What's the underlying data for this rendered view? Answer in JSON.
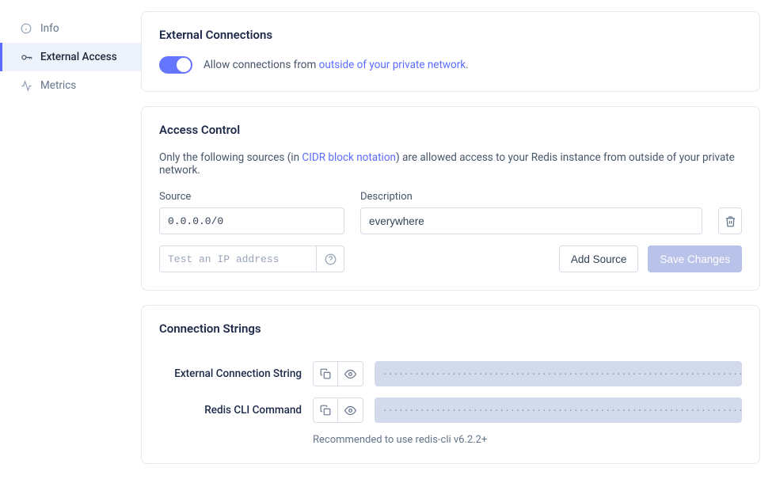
{
  "sidebar": {
    "items": [
      {
        "label": "Info"
      },
      {
        "label": "External Access"
      },
      {
        "label": "Metrics"
      }
    ]
  },
  "external_connections": {
    "title": "External Connections",
    "text_prefix": "Allow connections from ",
    "link_text": "outside of your private network",
    "text_suffix": "."
  },
  "access_control": {
    "title": "Access Control",
    "help_prefix": "Only the following sources (in ",
    "help_link": "CIDR block notation",
    "help_suffix": ") are allowed access to your Redis instance from outside of your private network.",
    "source_label": "Source",
    "description_label": "Description",
    "rows": [
      {
        "source": "0.0.0.0/0",
        "description": "everywhere"
      }
    ],
    "test_placeholder": "Test an IP address",
    "add_source_label": "Add Source",
    "save_changes_label": "Save Changes"
  },
  "connection_strings": {
    "title": "Connection Strings",
    "rows": [
      {
        "label": "External Connection String"
      },
      {
        "label": "Redis CLI Command"
      }
    ],
    "note": "Recommended to use redis-cli v6.2.2+",
    "mask": "•••••••••••••••••••••••••••••••••••••••••••••••••••••••••••••••••••••••••••••••••••••••••••••••••••"
  }
}
